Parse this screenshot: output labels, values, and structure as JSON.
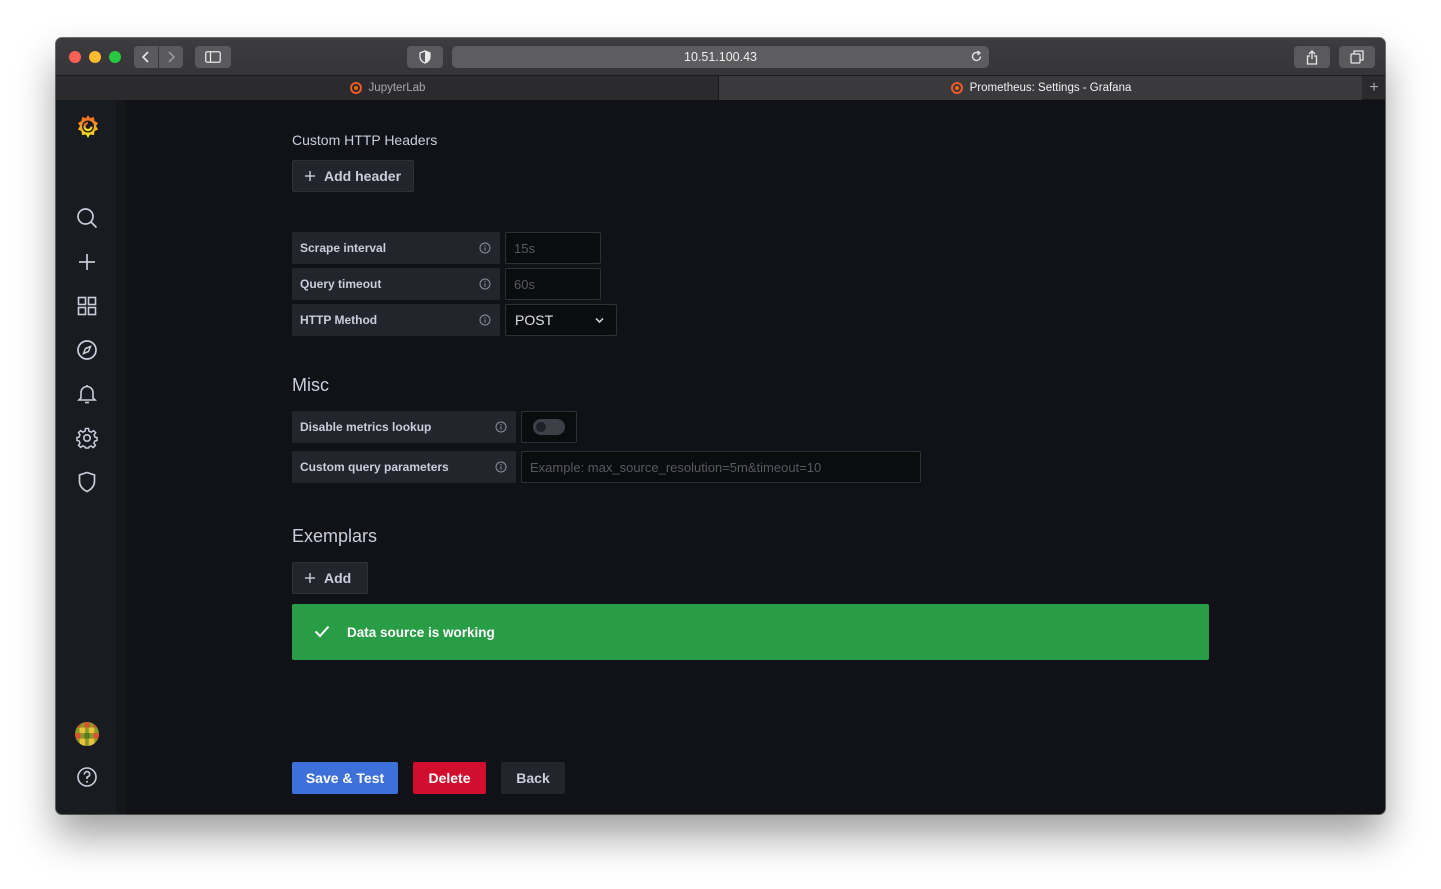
{
  "browser": {
    "url": "10.51.100.43",
    "tabs": [
      {
        "title": "JupyterLab",
        "active": false
      },
      {
        "title": "Prometheus: Settings - Grafana",
        "active": true
      }
    ],
    "new_tab_symbol": "+"
  },
  "sidebar": {
    "icons": [
      "grafana-logo-icon",
      "search-icon",
      "plus-icon",
      "dashboards-icon",
      "explore-icon",
      "alerting-icon",
      "gear-icon",
      "shield-icon",
      "avatar",
      "help-icon"
    ]
  },
  "http": {
    "custom_headers_title": "Custom HTTP Headers",
    "add_header_label": "Add header",
    "fields": {
      "scrape_interval": {
        "label": "Scrape interval",
        "placeholder": "15s"
      },
      "query_timeout": {
        "label": "Query timeout",
        "placeholder": "60s"
      },
      "http_method": {
        "label": "HTTP Method",
        "value": "POST"
      }
    }
  },
  "misc": {
    "title": "Misc",
    "disable_metrics_lookup": {
      "label": "Disable metrics lookup",
      "enabled": false
    },
    "custom_query_parameters": {
      "label": "Custom query parameters",
      "placeholder": "Example: max_source_resolution=5m&timeout=10"
    }
  },
  "exemplars": {
    "title": "Exemplars",
    "add_label": "Add"
  },
  "alert": {
    "message": "Data source is working",
    "color": "#299c46"
  },
  "actions": {
    "save_label": "Save & Test",
    "delete_label": "Delete",
    "back_label": "Back"
  },
  "colors": {
    "primary": "#3d71d9",
    "destructive": "#d10e2d",
    "brand": "#f05a28"
  }
}
